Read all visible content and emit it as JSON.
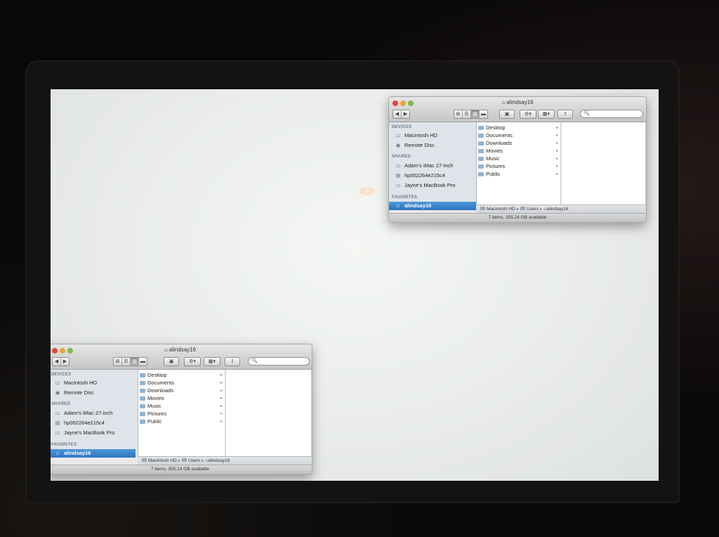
{
  "finder": {
    "title": "alindsay16",
    "toolbar": {
      "back_icon": "◀",
      "forward_icon": "▶",
      "view_icons": [
        "⊞",
        "☰",
        "▥",
        "▬"
      ],
      "path_icon": "▣",
      "action_icon": "⚙▾",
      "arrange_icon": "▦▾",
      "share_icon": "⇧",
      "search_placeholder": "🔍"
    },
    "sidebar": {
      "devices_header": "DEVICES",
      "devices": [
        {
          "label": "Macintosh HD",
          "icon": "▭"
        },
        {
          "label": "Remote Disc",
          "icon": "◉"
        }
      ],
      "shared_header": "SHARED",
      "shared": [
        {
          "label": "Adam’s iMac 27-inch",
          "icon": "▭"
        },
        {
          "label": "hp002264e215c4",
          "icon": "▤"
        },
        {
          "label": "Jayne’s MacBook Pro",
          "icon": "▭"
        }
      ],
      "favorites_header": "FAVORITES",
      "favorites": [
        {
          "label": "alindsay16",
          "icon": "⌂"
        }
      ]
    },
    "folders": [
      "Desktop",
      "Documents",
      "Downloads",
      "Movies",
      "Music",
      "Pictures",
      "Public"
    ],
    "folder_arrow": "▸",
    "pathbar": {
      "items": [
        "Macintosh HD",
        "Users",
        "alindsay16"
      ],
      "separator": "▸"
    },
    "status": "7 items, 355.24 GB available"
  },
  "colors": {
    "selection": "#2d74c0",
    "sidebar_bg": "#dfe4ea",
    "desktop": "#eceeec"
  }
}
